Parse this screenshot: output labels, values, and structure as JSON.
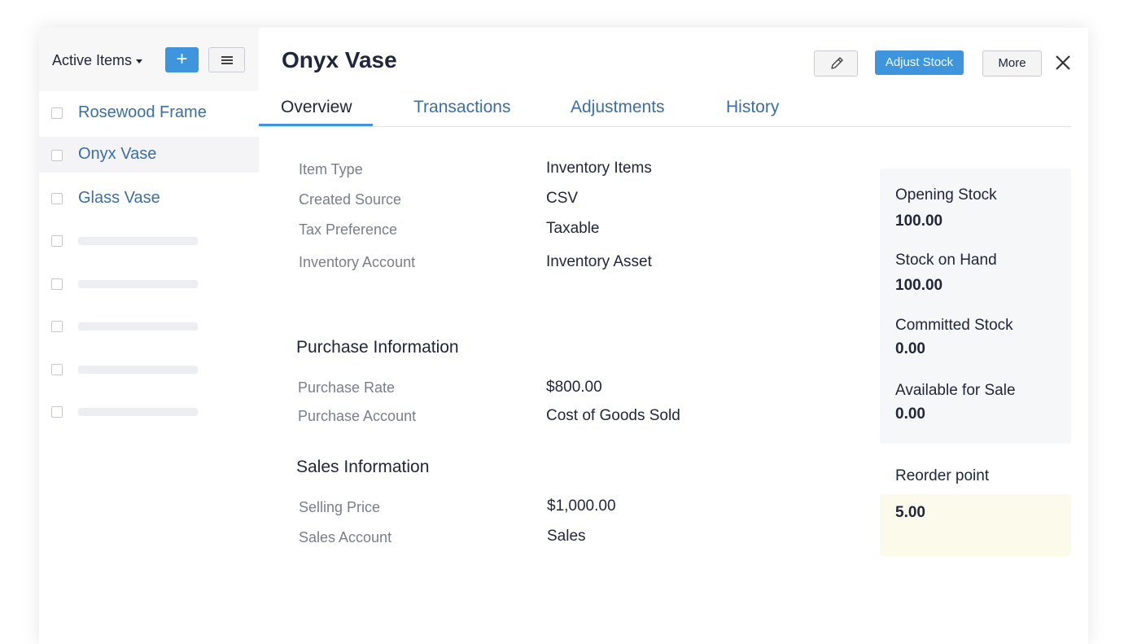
{
  "sidebar": {
    "filter_label": "Active Items",
    "add_label": "+",
    "items": [
      {
        "label": "Rosewood Frame"
      },
      {
        "label": "Onyx Vase"
      },
      {
        "label": "Glass Vase"
      }
    ]
  },
  "header": {
    "title": "Onyx Vase",
    "adjust_stock_label": "Adjust Stock",
    "more_label": "More"
  },
  "tabs": [
    {
      "label": "Overview"
    },
    {
      "label": "Transactions"
    },
    {
      "label": "Adjustments"
    },
    {
      "label": "History"
    }
  ],
  "overview": {
    "details": [
      {
        "label": "Item Type",
        "value": "Inventory Items"
      },
      {
        "label": "Created Source",
        "value": "CSV"
      },
      {
        "label": "Tax Preference",
        "value": "Taxable"
      },
      {
        "label": "Inventory Account",
        "value": "Inventory Asset"
      }
    ],
    "purchase": {
      "title": "Purchase Information",
      "rows": [
        {
          "label": "Purchase Rate",
          "value": "$800.00"
        },
        {
          "label": "Purchase Account",
          "value": "Cost of Goods Sold"
        }
      ]
    },
    "sales": {
      "title": "Sales Information",
      "rows": [
        {
          "label": "Selling Price",
          "value": "$1,000.00"
        },
        {
          "label": "Sales Account",
          "value": "Sales"
        }
      ]
    }
  },
  "stock": {
    "items": [
      {
        "label": "Opening Stock",
        "value": "100.00"
      },
      {
        "label": "Stock on Hand",
        "value": "100.00"
      },
      {
        "label": "Committed Stock",
        "value": "0.00"
      },
      {
        "label": "Available for Sale",
        "value": "0.00"
      }
    ],
    "reorder_label": "Reorder point",
    "reorder_value": "5.00"
  },
  "colors": {
    "accent": "#3e95de",
    "link": "#3c6ea4",
    "text": "#21263c",
    "muted": "#7a7e8c"
  }
}
